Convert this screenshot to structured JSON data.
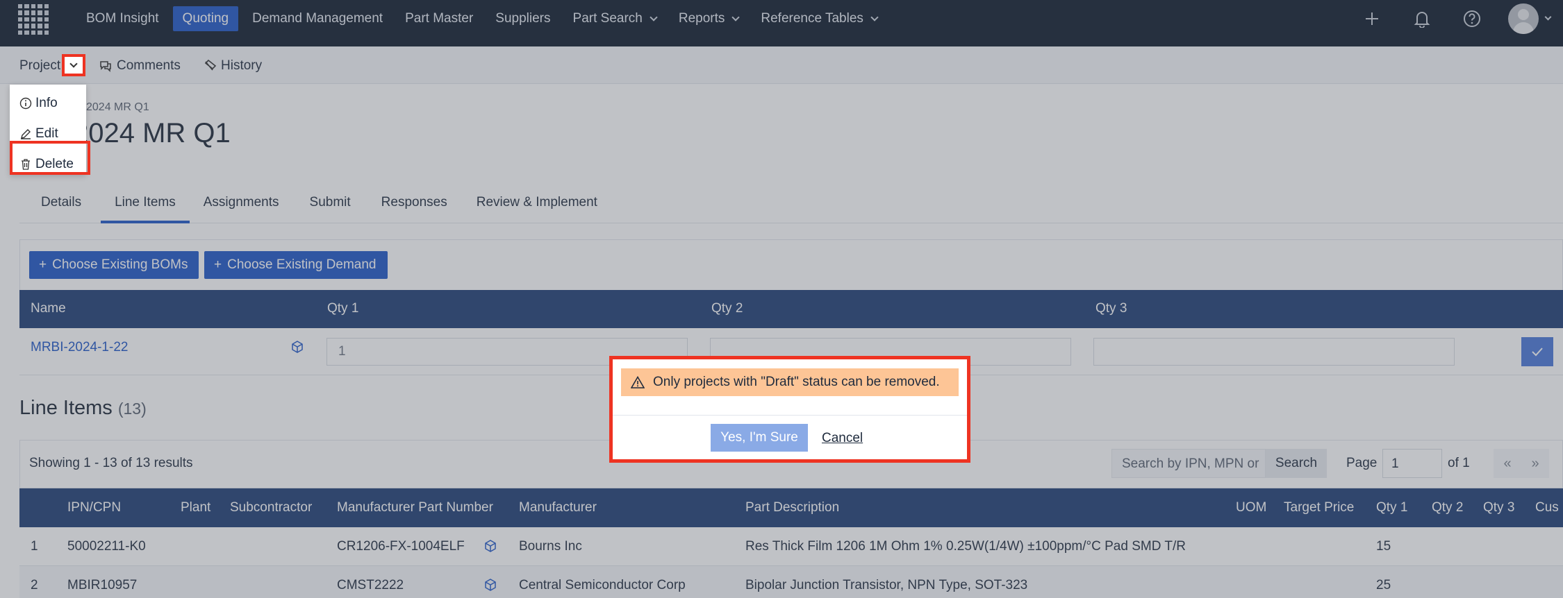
{
  "nav": {
    "items": [
      {
        "label": "BOM Insight",
        "active": false,
        "dropdown": false
      },
      {
        "label": "Quoting",
        "active": true,
        "dropdown": false
      },
      {
        "label": "Demand Management",
        "active": false,
        "dropdown": false
      },
      {
        "label": "Part Master",
        "active": false,
        "dropdown": false
      },
      {
        "label": "Suppliers",
        "active": false,
        "dropdown": false
      },
      {
        "label": "Part Search",
        "active": false,
        "dropdown": true
      },
      {
        "label": "Reports",
        "active": false,
        "dropdown": true
      },
      {
        "label": "Reference Tables",
        "active": false,
        "dropdown": true
      }
    ],
    "icons": [
      "plus-icon",
      "bell-icon",
      "help-icon",
      "avatar"
    ]
  },
  "subbar": {
    "project_label": "Project",
    "comments_label": "Comments",
    "history_label": "History"
  },
  "dropdown": {
    "items": [
      {
        "label": "Info",
        "icon": "info-icon"
      },
      {
        "label": "Edit",
        "icon": "edit-icon"
      },
      {
        "label": "Delete",
        "icon": "trash-icon"
      }
    ]
  },
  "page": {
    "breadcrumb": "2024 MR Q1",
    "title": "2024 MR Q1"
  },
  "tabs": [
    "Details",
    "Line Items",
    "Assignments",
    "Submit",
    "Responses",
    "Review & Implement"
  ],
  "actions": {
    "choose_boms": "Choose Existing BOMs",
    "choose_demand": "Choose Existing Demand"
  },
  "demand_table": {
    "headers": [
      "Name",
      "Qty 1",
      "Qty 2",
      "Qty 3"
    ],
    "row": {
      "name": "MRBI-2024-1-22",
      "qty1": "1",
      "qty2": "",
      "qty3": ""
    }
  },
  "line_items": {
    "title": "Line Items",
    "count": "(13)",
    "showing": "Showing 1 - 13 of 13 results",
    "search_placeholder": "Search by IPN, MPN or",
    "search_button": "Search",
    "page_label": "Page",
    "page_value": "1",
    "page_of": "of 1",
    "prev": "«",
    "next": "»",
    "headers": [
      "IPN/CPN",
      "Plant",
      "Subcontractor",
      "Manufacturer Part Number",
      "Manufacturer",
      "Part Description",
      "UOM",
      "Target Price",
      "Qty 1",
      "Qty 2",
      "Qty 3",
      "Cus"
    ],
    "rows": [
      {
        "num": "1",
        "ipn": "50002211-K0",
        "mpn": "CR1206-FX-1004ELF",
        "manufacturer": "Bourns Inc",
        "description": "Res Thick Film 1206 1M Ohm 1% 0.25W(1/4W) ±100ppm/°C Pad SMD T/R",
        "qty1": "15"
      },
      {
        "num": "2",
        "ipn": "MBIR10957",
        "mpn": "CMST2222",
        "manufacturer": "Central Semiconductor Corp",
        "description": "Bipolar Junction Transistor, NPN Type, SOT-323",
        "qty1": "25"
      }
    ]
  },
  "modal": {
    "warning": "Only projects with \"Draft\" status can be removed.",
    "confirm": "Yes, I'm Sure",
    "cancel": "Cancel"
  },
  "colors": {
    "nav_bg": "#0f1b2d",
    "accent": "#1f56c7",
    "table_head": "#1f3d75",
    "warning_bg": "#fdc596",
    "highlight": "#ee3322"
  }
}
